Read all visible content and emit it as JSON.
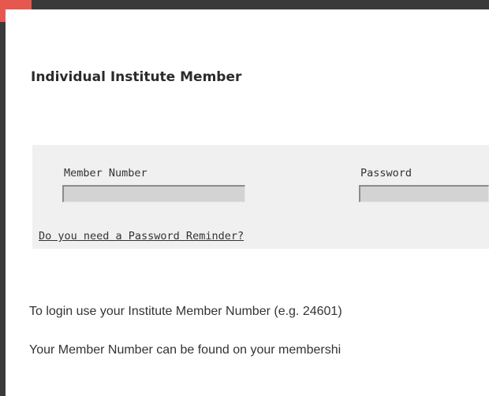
{
  "section_title": "Individual Institute Member",
  "login": {
    "member_number_label": "Member Number",
    "member_number_value": "",
    "password_label": "Password",
    "password_value": "",
    "reminder_link": "Do you need a Password Reminder?"
  },
  "info": {
    "line1": "To login use your Institute Member Number (e.g. 24601)",
    "line2": "Your Member Number can be found on your membershi"
  },
  "colors": {
    "frame": "#3a3a3a",
    "accent": "#e8574f",
    "panel_bg": "#f0f0f0",
    "input_bg": "#d3d3d3"
  }
}
